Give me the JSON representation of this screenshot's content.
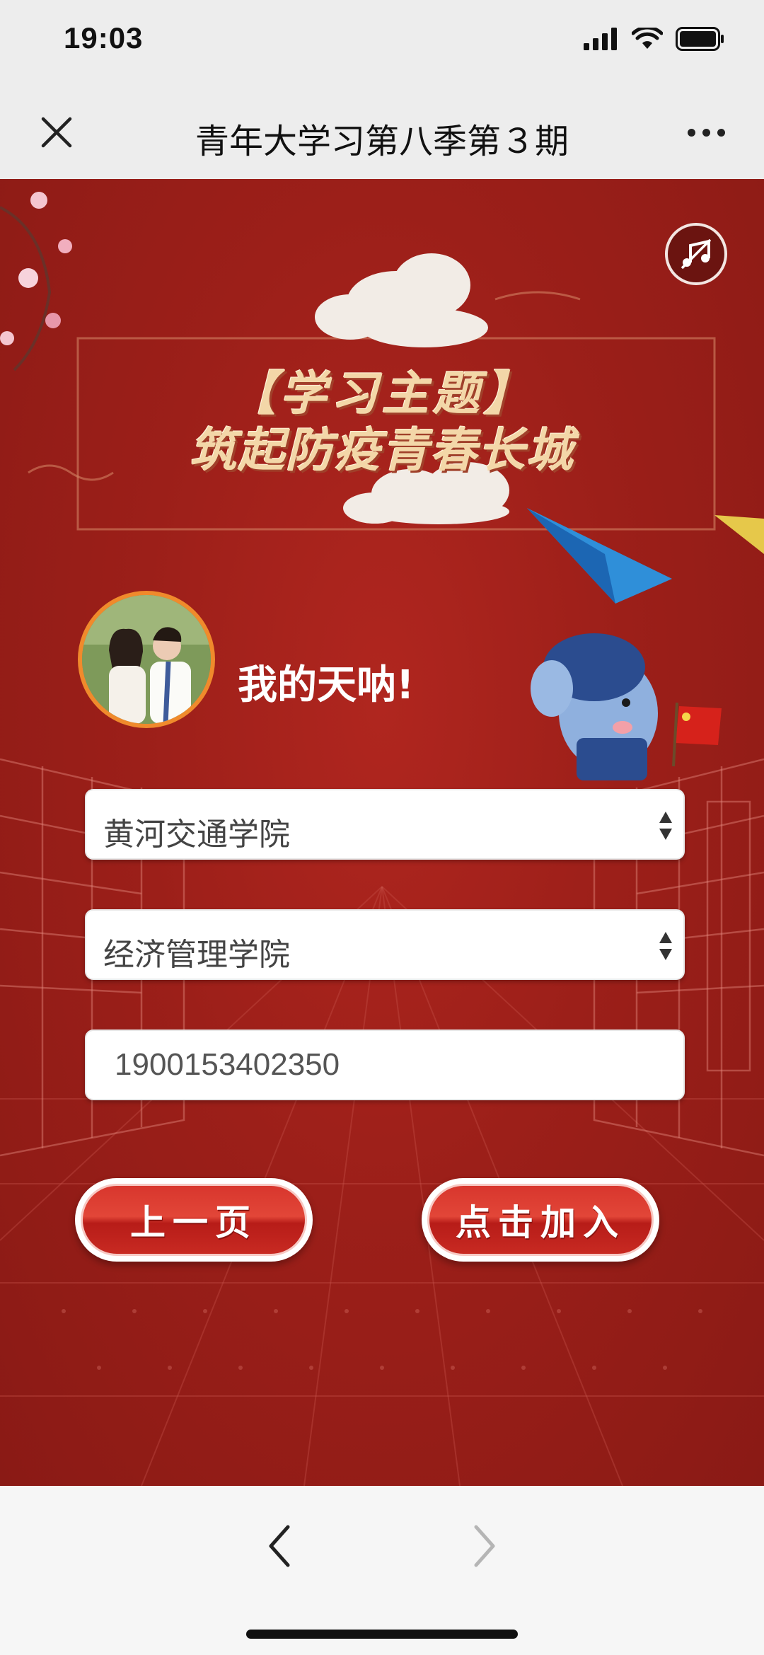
{
  "status_bar": {
    "time": "19:03"
  },
  "nav": {
    "title": "青年大学习第八季第３期"
  },
  "banner": {
    "line1": "【学习主题】",
    "line2": "筑起防疫青春长城"
  },
  "user": {
    "name": "我的天呐!"
  },
  "form": {
    "school_select": "黄河交通学院",
    "college_select": "经济管理学院",
    "id_input": "1900153402350"
  },
  "buttons": {
    "prev": "上一页",
    "join": "点击加入"
  },
  "colors": {
    "main_bg": "#9c1f19",
    "accent": "#f08a2c",
    "button": "#d8362d"
  },
  "icons": [
    "signal-icon",
    "wifi-icon",
    "battery-icon",
    "close-icon",
    "more-icon",
    "music-icon",
    "back-arrow-icon",
    "forward-arrow-icon"
  ]
}
